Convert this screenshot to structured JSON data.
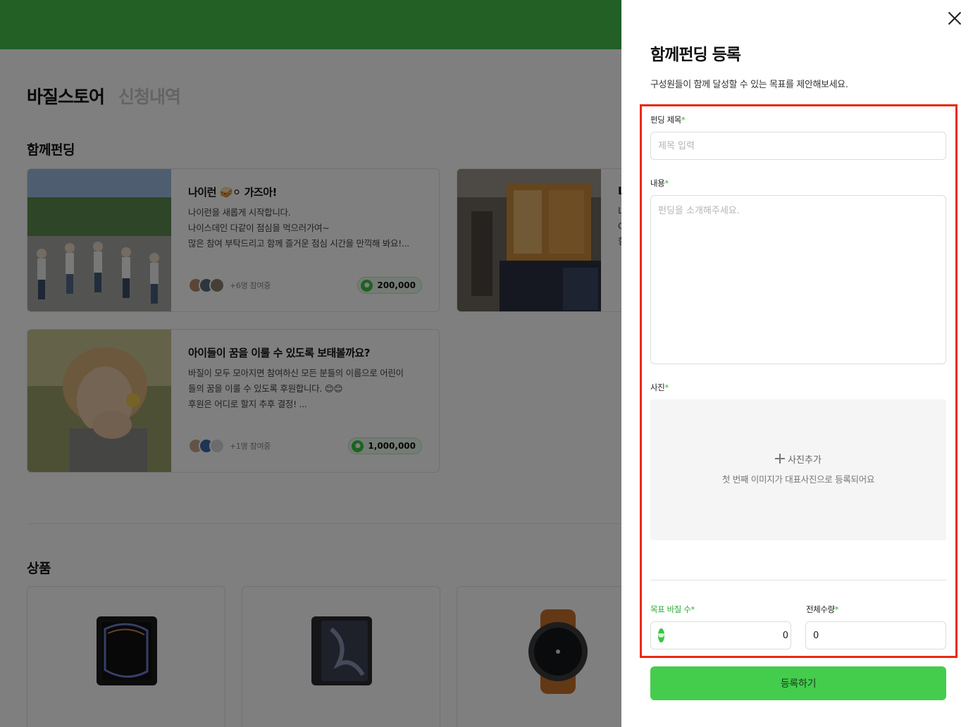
{
  "background": {
    "tabs": [
      "바질스토어",
      "신청내역"
    ],
    "funding_section_title": "함께펀딩",
    "products_section_title": "상품",
    "funding_cards": [
      {
        "title": "나이런 🥪⚪ 가즈아!",
        "desc": [
          "나이런을 새롭게 시작합니다.",
          "나이스데인 다같이 점심을 먹으러가여~",
          "많은 참여 부탁드리고 함께 즐거운 점심 시간을 만끽해 봐요!..."
        ],
        "participants": "+6명 참여중",
        "amount": "200,000"
      },
      {
        "title": "아이들이 꿈을 이룰 수 있도록 보태볼까요?",
        "desc": [
          "바질이 모두 모아지면 참여하신 모든 분들의 이름으로 어린이",
          "들의 꿈을 이룰 수 있도록 후원합니다. 😊😊",
          "후원은 어디로 할지 추후 결정! ..."
        ],
        "participants": "+1명 참여중",
        "amount": "1,000,000"
      },
      {
        "title": "L",
        "desc": [
          "L",
          "C",
          "힘"
        ]
      }
    ]
  },
  "modal": {
    "title": "함께펀딩 등록",
    "subtitle": "구성원들이 함께 달성할 수 있는 목표를 제안해보세요.",
    "title_field": {
      "label": "펀딩 제목",
      "required_mark": "*",
      "placeholder": "제목 입력"
    },
    "content_field": {
      "label": "내용",
      "required_mark": "*",
      "placeholder": "펀딩을 소개해주세요."
    },
    "photo_field": {
      "label": "사진",
      "required_mark": "*",
      "add_label": "사진추가",
      "hint": "첫 번째 이미지가 대표사진으로 등록되어요"
    },
    "target_field": {
      "label": "목표 바질 수",
      "required_mark": "*",
      "value": "0"
    },
    "total_field": {
      "label": "전체수량",
      "required_mark": "*",
      "value": "0"
    },
    "submit_label": "등록하기"
  },
  "colors": {
    "brand_green": "#44c04a",
    "required_green": "#2db838",
    "highlight_red": "#ea2a10",
    "submit_green": "#44cc4c"
  },
  "icons": [
    "close-icon",
    "plus-icon",
    "basil-coin-icon"
  ]
}
